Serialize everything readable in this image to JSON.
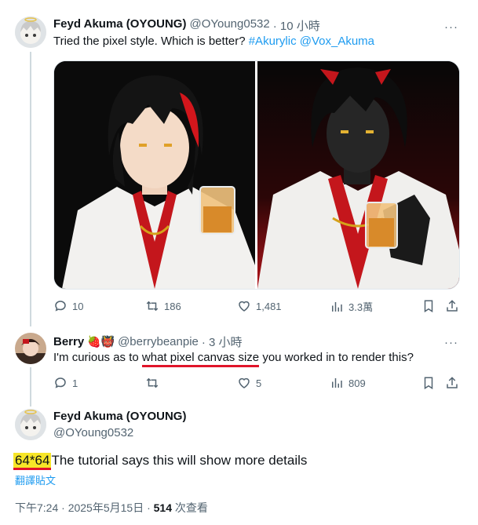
{
  "tweet1": {
    "author_name": "Feyd Akuma (OYOUNG)",
    "handle": "@OYoung0532",
    "time": "· 10 小時",
    "text_prefix": "Tried the pixel style. Which is better? ",
    "mention1": "#Akurylic",
    "mention2": "@Vox_Akuma",
    "replies": "10",
    "retweets": "186",
    "likes": "1,481",
    "views": "3.3萬",
    "more": "···"
  },
  "reply": {
    "author_name": "Berry",
    "emoji": "🍓👹",
    "handle": "@berrybeanpie",
    "time": "· 3 小時",
    "text_prefix": "I'm curious as to ",
    "text_underlined": "what pixel canvas size",
    "text_suffix": " you worked in to render this?",
    "replies": "1",
    "likes": "5",
    "views": "809",
    "more": "···"
  },
  "tweet2": {
    "author_name": "Feyd Akuma (OYOUNG)",
    "handle": "@OYoung0532",
    "highlight_text": "64*64",
    "text_rest": "The tutorial says this will show more details",
    "translate": "翻譯貼文",
    "timestamp": "下午7:24 · 2025年5月15日 · ",
    "views_count": "514",
    "views_label": " 次查看"
  },
  "colors": {
    "link": "#1d9bf0",
    "secondary": "#536471",
    "highlight": "#f7e628",
    "annotation_red": "#e0142a"
  }
}
